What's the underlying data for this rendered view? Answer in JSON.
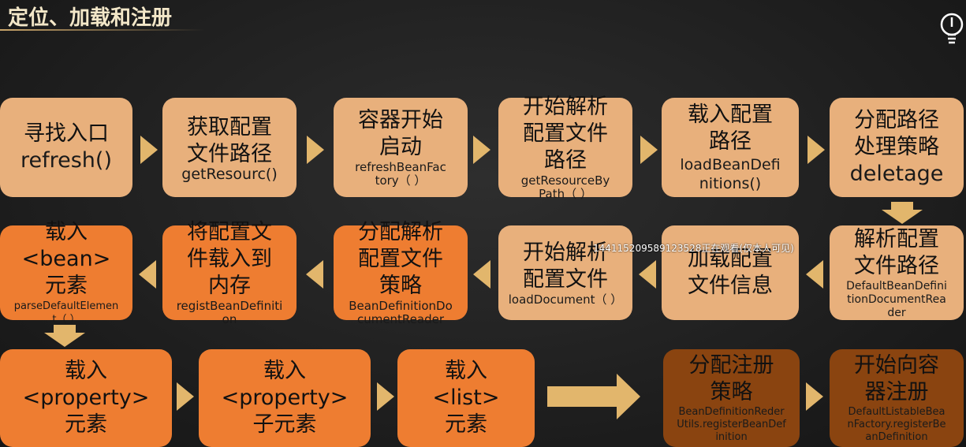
{
  "title": "定位、加载和注册",
  "watermark": "1441152095891235​28正在观看(仅本人可见)",
  "icons": {
    "top_right": "lightbulb-icon"
  },
  "colors": {
    "tan": "#e8b07c",
    "orange": "#ee7d31",
    "brown": "#8a4410",
    "arrow": "#e2b66c"
  },
  "row1": [
    {
      "cn": "寻找入口",
      "en": "refresh()"
    },
    {
      "cn": "获取配置\n文件路径",
      "en": "getResourc()"
    },
    {
      "cn": "容器开始\n启动",
      "en": "refreshBeanFac\ntory（ ）"
    },
    {
      "cn": "开始解析\n配置文件\n路径",
      "en": "getResourceBy\nPath（ ）"
    },
    {
      "cn": "载入配置\n路径",
      "en": "loadBeanDefi\nnitions()"
    },
    {
      "cn": "分配路径\n处理策略",
      "en": "deletage"
    }
  ],
  "row2": [
    {
      "cn": "载入\n<bean>\n元素",
      "en": "parseDefaultElemen\nt（ ）"
    },
    {
      "cn": "将配置文\n件载入到\n内存",
      "en": "registBeanDefiniti\non"
    },
    {
      "cn": "分配解析\n配置文件\n策略",
      "en": "BeanDefinitionDo\ncumentReader"
    },
    {
      "cn": "开始解析\n配置文件",
      "en": "loadDocument（ ）"
    },
    {
      "cn": "加载配置\n文件信息",
      "en": ""
    },
    {
      "cn": "解析配置\n文件路径",
      "en": "DefaultBeanDefini\ntionDocumentRea\nder"
    }
  ],
  "row3": [
    {
      "cn": "载入\n<property>\n元素",
      "en": ""
    },
    {
      "cn": "载入\n<property>\n子元素",
      "en": ""
    },
    {
      "cn": "载入\n<list>\n元素",
      "en": ""
    },
    {
      "cn": "分配注册\n策略",
      "en": "BeanDefinitionReder\nUtils.registerBeanDef\ninition"
    },
    {
      "cn": "开始向容\n器注册",
      "en": "DefaultListableBea\nnFactory.registerBe\nanDefinition"
    }
  ]
}
